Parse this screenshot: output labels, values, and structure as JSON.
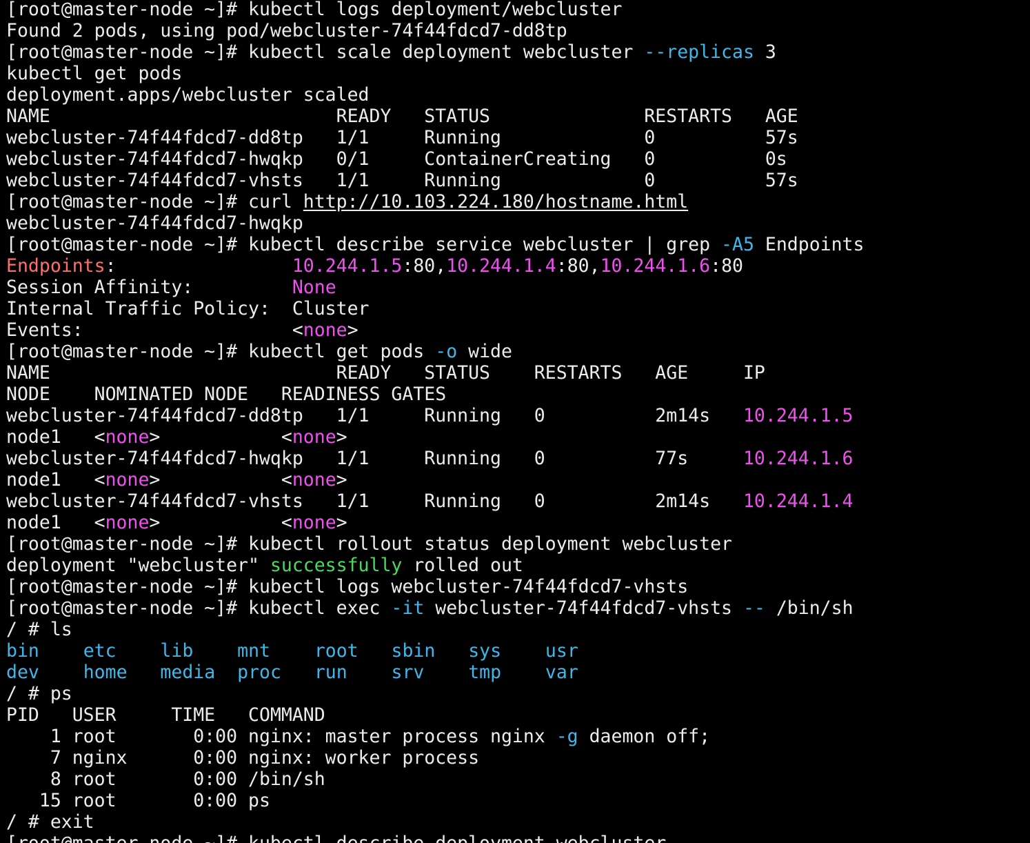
{
  "colors": {
    "background": "#000000",
    "text": "#ececec",
    "flag": "#3fb7ea",
    "magenta": "#f050f0",
    "red": "#ff6e6e",
    "green": "#4dd860",
    "directory": "#3fb7ea"
  },
  "terminal": {
    "lines": [
      [
        {
          "t": "[root@master-node ~]# kubectl logs deployment/webcluster",
          "c": "default"
        }
      ],
      [
        {
          "t": "Found 2 pods, using pod/webcluster-74f44fdcd7-dd8tp",
          "c": "default"
        }
      ],
      [
        {
          "t": "[root@master-node ~]# kubectl scale deployment webcluster ",
          "c": "default"
        },
        {
          "t": "--replicas",
          "c": "flag"
        },
        {
          "t": " 3",
          "c": "default"
        }
      ],
      [
        {
          "t": "kubectl get pods",
          "c": "default"
        }
      ],
      [
        {
          "t": "deployment.apps/webcluster scaled",
          "c": "default"
        }
      ],
      [
        {
          "t": "NAME                          READY   STATUS              RESTARTS   AGE",
          "c": "default"
        }
      ],
      [
        {
          "t": "webcluster-74f44fdcd7-dd8tp   1/1     Running             0          57s",
          "c": "default"
        }
      ],
      [
        {
          "t": "webcluster-74f44fdcd7-hwqkp   0/1     ContainerCreating   0          0s",
          "c": "default"
        }
      ],
      [
        {
          "t": "webcluster-74f44fdcd7-vhsts   1/1     Running             0          57s",
          "c": "default"
        }
      ],
      [
        {
          "t": "[root@master-node ~]# curl ",
          "c": "default"
        },
        {
          "t": "http://10.103.224.180/hostname.html",
          "c": "link"
        }
      ],
      [
        {
          "t": "webcluster-74f44fdcd7-hwqkp",
          "c": "default"
        }
      ],
      [
        {
          "t": "[root@master-node ~]# kubectl describe service webcluster | grep ",
          "c": "default"
        },
        {
          "t": "-A5",
          "c": "flag"
        },
        {
          "t": " Endpoints",
          "c": "default"
        }
      ],
      [
        {
          "t": "Endpoints",
          "c": "red"
        },
        {
          "t": ":                ",
          "c": "default"
        },
        {
          "t": "10.244.1.5",
          "c": "magenta"
        },
        {
          "t": ":80,",
          "c": "default"
        },
        {
          "t": "10.244.1.4",
          "c": "magenta"
        },
        {
          "t": ":80,",
          "c": "default"
        },
        {
          "t": "10.244.1.6",
          "c": "magenta"
        },
        {
          "t": ":80",
          "c": "default"
        }
      ],
      [
        {
          "t": "Session Affinity:         ",
          "c": "default"
        },
        {
          "t": "None",
          "c": "magenta"
        }
      ],
      [
        {
          "t": "Internal Traffic Policy:  Cluster",
          "c": "default"
        }
      ],
      [
        {
          "t": "Events:                   <",
          "c": "default"
        },
        {
          "t": "none",
          "c": "magenta"
        },
        {
          "t": ">",
          "c": "default"
        }
      ],
      [
        {
          "t": "[root@master-node ~]# kubectl get pods ",
          "c": "default"
        },
        {
          "t": "-o",
          "c": "flag"
        },
        {
          "t": " wide",
          "c": "default"
        }
      ],
      [
        {
          "t": "NAME                          READY   STATUS    RESTARTS   AGE     IP",
          "c": "default"
        }
      ],
      [
        {
          "t": "NODE    NOMINATED NODE   READINESS GATES",
          "c": "default"
        }
      ],
      [
        {
          "t": "webcluster-74f44fdcd7-dd8tp   1/1     Running   0          2m14s   ",
          "c": "default"
        },
        {
          "t": "10.244.1.5",
          "c": "magenta"
        }
      ],
      [
        {
          "t": "node1   <",
          "c": "default"
        },
        {
          "t": "none",
          "c": "magenta"
        },
        {
          "t": ">           <",
          "c": "default"
        },
        {
          "t": "none",
          "c": "magenta"
        },
        {
          "t": ">",
          "c": "default"
        }
      ],
      [
        {
          "t": "webcluster-74f44fdcd7-hwqkp   1/1     Running   0          77s     ",
          "c": "default"
        },
        {
          "t": "10.244.1.6",
          "c": "magenta"
        }
      ],
      [
        {
          "t": "node1   <",
          "c": "default"
        },
        {
          "t": "none",
          "c": "magenta"
        },
        {
          "t": ">           <",
          "c": "default"
        },
        {
          "t": "none",
          "c": "magenta"
        },
        {
          "t": ">",
          "c": "default"
        }
      ],
      [
        {
          "t": "webcluster-74f44fdcd7-vhsts   1/1     Running   0          2m14s   ",
          "c": "default"
        },
        {
          "t": "10.244.1.4",
          "c": "magenta"
        }
      ],
      [
        {
          "t": "node1   <",
          "c": "default"
        },
        {
          "t": "none",
          "c": "magenta"
        },
        {
          "t": ">           <",
          "c": "default"
        },
        {
          "t": "none",
          "c": "magenta"
        },
        {
          "t": ">",
          "c": "default"
        }
      ],
      [
        {
          "t": "[root@master-node ~]# kubectl rollout status deployment webcluster",
          "c": "default"
        }
      ],
      [
        {
          "t": "deployment \"webcluster\" ",
          "c": "default"
        },
        {
          "t": "successfully",
          "c": "green"
        },
        {
          "t": " rolled out",
          "c": "default"
        }
      ],
      [
        {
          "t": "[root@master-node ~]# kubectl logs webcluster-74f44fdcd7-vhsts",
          "c": "default"
        }
      ],
      [
        {
          "t": "[root@master-node ~]# kubectl exec ",
          "c": "default"
        },
        {
          "t": "-it",
          "c": "flag"
        },
        {
          "t": " webcluster-74f44fdcd7-vhsts ",
          "c": "default"
        },
        {
          "t": "--",
          "c": "flag"
        },
        {
          "t": " /bin/sh",
          "c": "default"
        }
      ],
      [
        {
          "t": "/ # ls",
          "c": "default"
        }
      ],
      [
        {
          "t": "bin",
          "c": "dir"
        },
        {
          "t": "    ",
          "c": "default"
        },
        {
          "t": "etc",
          "c": "dir"
        },
        {
          "t": "    ",
          "c": "default"
        },
        {
          "t": "lib",
          "c": "dir"
        },
        {
          "t": "    ",
          "c": "default"
        },
        {
          "t": "mnt",
          "c": "dir"
        },
        {
          "t": "    ",
          "c": "default"
        },
        {
          "t": "root",
          "c": "dir"
        },
        {
          "t": "   ",
          "c": "default"
        },
        {
          "t": "sbin",
          "c": "dir"
        },
        {
          "t": "   ",
          "c": "default"
        },
        {
          "t": "sys",
          "c": "dir"
        },
        {
          "t": "    ",
          "c": "default"
        },
        {
          "t": "usr",
          "c": "dir"
        }
      ],
      [
        {
          "t": "dev",
          "c": "dir"
        },
        {
          "t": "    ",
          "c": "default"
        },
        {
          "t": "home",
          "c": "dir"
        },
        {
          "t": "   ",
          "c": "default"
        },
        {
          "t": "media",
          "c": "dir"
        },
        {
          "t": "  ",
          "c": "default"
        },
        {
          "t": "proc",
          "c": "dir"
        },
        {
          "t": "   ",
          "c": "default"
        },
        {
          "t": "run",
          "c": "dir"
        },
        {
          "t": "    ",
          "c": "default"
        },
        {
          "t": "srv",
          "c": "dir"
        },
        {
          "t": "    ",
          "c": "default"
        },
        {
          "t": "tmp",
          "c": "dir"
        },
        {
          "t": "    ",
          "c": "default"
        },
        {
          "t": "var",
          "c": "dir"
        }
      ],
      [
        {
          "t": "/ # ps",
          "c": "default"
        }
      ],
      [
        {
          "t": "PID   USER     TIME   COMMAND",
          "c": "default"
        }
      ],
      [
        {
          "t": "    1 root       0:00 nginx: master process nginx ",
          "c": "default"
        },
        {
          "t": "-g",
          "c": "flag"
        },
        {
          "t": " daemon off;",
          "c": "default"
        }
      ],
      [
        {
          "t": "    7 nginx      0:00 nginx: worker process",
          "c": "default"
        }
      ],
      [
        {
          "t": "    8 root       0:00 /bin/sh",
          "c": "default"
        }
      ],
      [
        {
          "t": "   15 root       0:00 ps",
          "c": "default"
        }
      ],
      [
        {
          "t": "/ # exit",
          "c": "default"
        }
      ],
      [
        {
          "t": "[root@master-node ~]# kubectl describe deployment webcluster",
          "c": "default"
        }
      ]
    ]
  }
}
